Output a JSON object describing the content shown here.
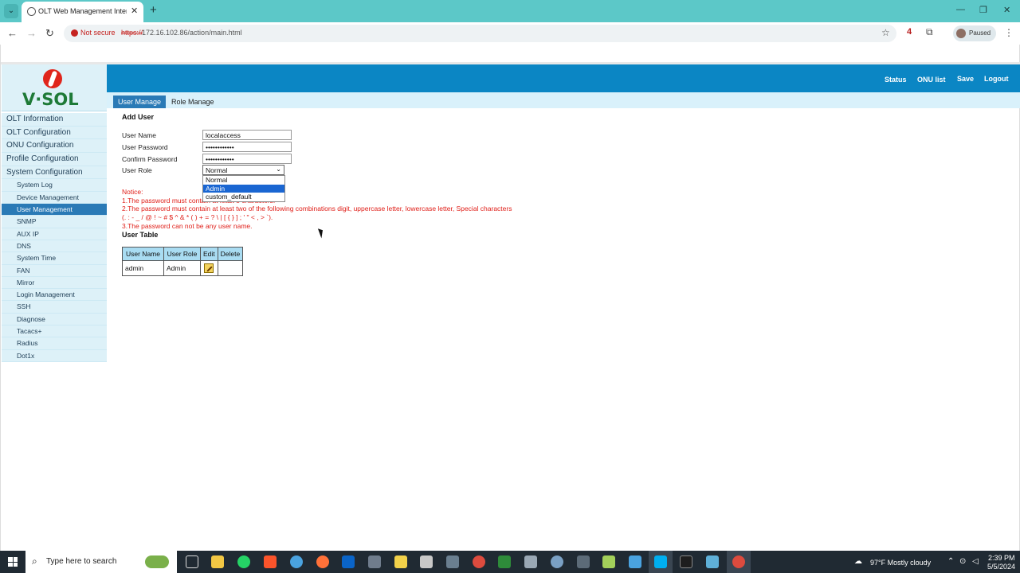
{
  "browser": {
    "tab_title": "OLT Web Management Interface",
    "not_secure": "Not secure",
    "url_scheme": "https://",
    "url_rest": "172.16.102.86/action/main.html",
    "ext_badge": "4",
    "profile_status": "Paused"
  },
  "brand": {
    "logo_text": "V·SOL"
  },
  "topnav": {
    "status": "Status",
    "onu_list": "ONU list",
    "save": "Save",
    "logout": "Logout"
  },
  "subtabs": {
    "user_manage": "User Manage",
    "role_manage": "Role Manage"
  },
  "sidebar": {
    "main_items": [
      "OLT Information",
      "OLT Configuration",
      "ONU Configuration",
      "Profile Configuration",
      "System Configuration"
    ],
    "sub_items": [
      "System Log",
      "Device Management",
      "User Management",
      "SNMP",
      "AUX IP",
      "DNS",
      "System Time",
      "FAN",
      "Mirror",
      "Login Management",
      "SSH",
      "Diagnose",
      "Tacacs+",
      "Radius",
      "Dot1x"
    ],
    "active_sub": "User Management"
  },
  "form": {
    "title": "Add User",
    "user_name_label": "User Name",
    "user_name_value": "localaccess",
    "password_label": "User Password",
    "password_value": "••••••••••••",
    "confirm_label": "Confirm Password",
    "confirm_value": "••••••••••••",
    "role_label": "User Role",
    "role_selected": "Normal",
    "role_options": [
      "Normal",
      "Admin",
      "custom_default"
    ],
    "role_highlighted": "Admin"
  },
  "notice": {
    "title": "Notice:",
    "line1": "1.The password must contain at least 8 characters.",
    "line2": "2.The password must contain at least two of the following combinations digit, uppercase letter, lowercase letter, Special characters",
    "line2b": "(. : - _ / @ ! ~ # $ ^ & * ( ) + = ? \\ | [ { } ] ; ' \" < , > `).",
    "line3": "3.The password can not be any user name."
  },
  "user_table": {
    "title": "User Table",
    "headers": [
      "User Name",
      "User Role",
      "Edit",
      "Delete"
    ],
    "rows": [
      {
        "user_name": "admin",
        "user_role": "Admin"
      }
    ]
  },
  "taskbar": {
    "search_placeholder": "Type here to search",
    "weather": "97°F  Mostly cloudy",
    "time": "2:39 PM",
    "date": "5/5/2024"
  },
  "colors": {
    "brand_blue": "#0b86c4",
    "active_item": "#2a7ab6",
    "notice_red": "#e0201a",
    "logo_green": "#1e7a37"
  }
}
